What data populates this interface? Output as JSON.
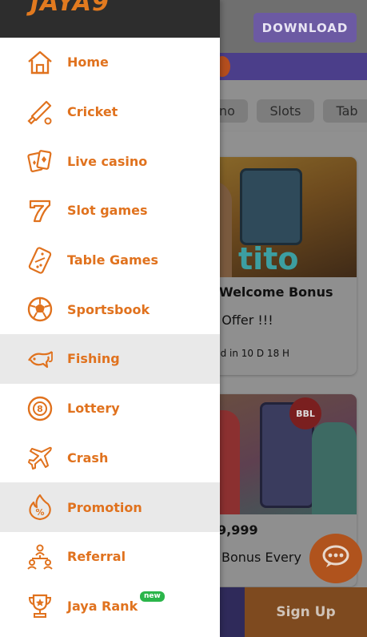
{
  "header": {
    "brand": "JAYA9",
    "download_label": "DOWNLOAD"
  },
  "tabs": [
    "no",
    "Slots",
    "Tab"
  ],
  "cards": [
    {
      "image_text": "tito",
      "title": "Welcome Bonus",
      "subtitle": "d Offer !!!",
      "meta": "nd in 10 D 18 H"
    },
    {
      "image_badge": "BBL",
      "amount": "9,999",
      "subtitle": "Bonus Every"
    }
  ],
  "bottom": {
    "signup_label": "Sign Up"
  },
  "menu": {
    "items": [
      {
        "label": "Home",
        "icon": "home-icon"
      },
      {
        "label": "Cricket",
        "icon": "cricket-icon"
      },
      {
        "label": "Live casino",
        "icon": "cards-icon"
      },
      {
        "label": "Slot games",
        "icon": "seven-icon"
      },
      {
        "label": "Table Games",
        "icon": "domino-icon"
      },
      {
        "label": "Sportsbook",
        "icon": "football-icon"
      },
      {
        "label": "Fishing",
        "icon": "fish-icon",
        "active": true
      },
      {
        "label": "Lottery",
        "icon": "lottery-ball-icon"
      },
      {
        "label": "Crash",
        "icon": "plane-icon"
      },
      {
        "label": "Promotion",
        "icon": "percent-flame-icon",
        "active": true
      },
      {
        "label": "Referral",
        "icon": "referral-tree-icon"
      },
      {
        "label": "Jaya Rank",
        "icon": "trophy-icon",
        "badge": "new"
      }
    ]
  },
  "colors": {
    "accent": "#e0721e",
    "active_bg": "#e9e9e9",
    "badge_green": "#2bb54a"
  }
}
